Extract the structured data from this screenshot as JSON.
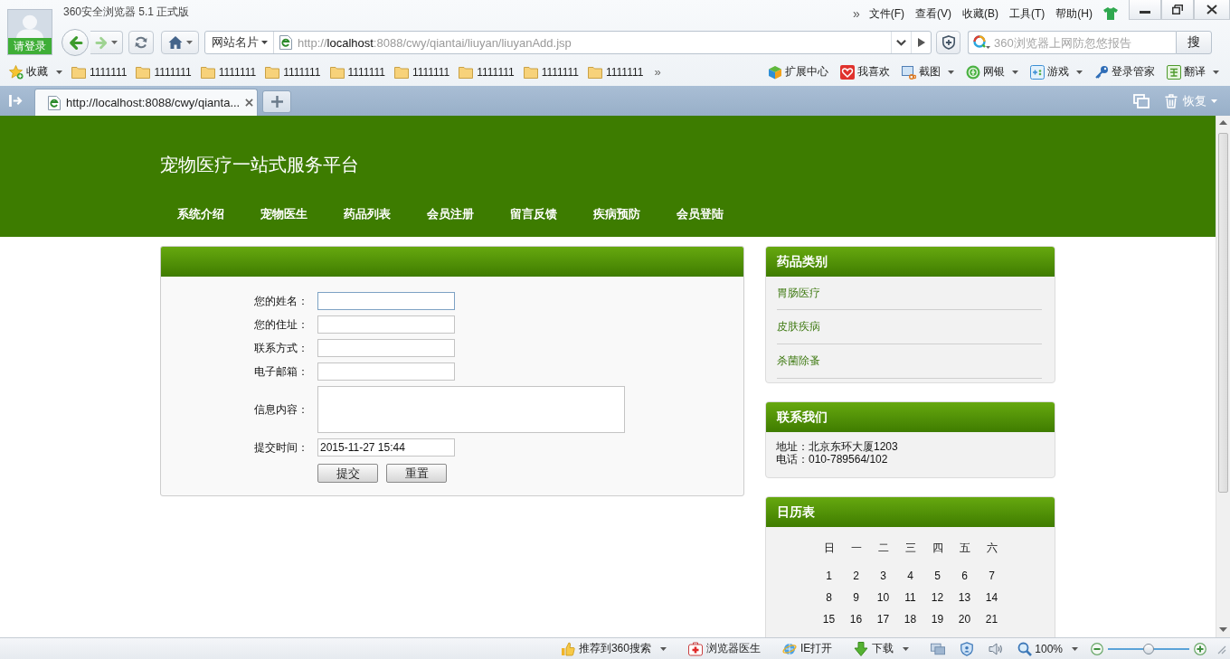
{
  "browser": {
    "title": "360安全浏览器 5.1 正式版",
    "login_label": "请登录",
    "menu_overflow": "»",
    "menu": [
      "文件(F)",
      "查看(V)",
      "收藏(B)",
      "工具(T)",
      "帮助(H)"
    ],
    "site_card": "网站名片",
    "address": "http://**localhost**:8088/cwy/qiantai/liuyan/liuyanAdd.jsp",
    "search": {
      "placeholder": "360浏览器上网防忽悠报告",
      "button": "搜"
    }
  },
  "bookmarks": {
    "favorites": "收藏",
    "folders": [
      "1111111",
      "1111111",
      "1111111",
      "1111111",
      "1111111",
      "1111111",
      "1111111",
      "1111111",
      "1111111"
    ],
    "overflow": "»",
    "tools": [
      {
        "label": "扩展中心",
        "dropdown": false
      },
      {
        "label": "我喜欢",
        "dropdown": false
      },
      {
        "label": "截图",
        "dropdown": true
      },
      {
        "label": "网银",
        "dropdown": true
      },
      {
        "label": "游戏",
        "dropdown": true
      },
      {
        "label": "登录管家",
        "dropdown": false
      },
      {
        "label": "翻译",
        "dropdown": true
      }
    ]
  },
  "tabs": {
    "items": [
      {
        "title": "http://localhost:8088/cwy/qianta...",
        "selected": true
      }
    ],
    "restore": "恢复"
  },
  "site": {
    "title": "宠物医疗一站式服务平台",
    "nav": [
      "系统介绍",
      "宠物医生",
      "药品列表",
      "会员注册",
      "留言反馈",
      "疾病预防",
      "会员登陆"
    ]
  },
  "form": {
    "fields": [
      {
        "label": "您的姓名：",
        "kind": "input",
        "focused": true
      },
      {
        "label": "您的住址：",
        "kind": "input",
        "focused": false
      },
      {
        "label": "联系方式：",
        "kind": "input",
        "focused": false
      },
      {
        "label": "电子邮箱：",
        "kind": "input",
        "focused": false
      },
      {
        "label": "信息内容：",
        "kind": "textarea",
        "focused": false
      },
      {
        "label": "提交时间：",
        "kind": "input",
        "focused": false,
        "value": "2015-11-27 15:44"
      }
    ],
    "buttons": [
      "提交",
      "重置"
    ]
  },
  "sidebar": {
    "categories": {
      "title": "药品类别",
      "items": [
        "胃肠医疗",
        "皮肤疾病",
        "杀菌除蚤"
      ]
    },
    "contact": {
      "title": "联系我们",
      "lines": [
        "地址：北京东环大厦1203",
        "电话：010-789564/102"
      ]
    },
    "calendar": {
      "title": "日历表",
      "weekdays": [
        "日",
        "一",
        "二",
        "三",
        "四",
        "五",
        "六"
      ],
      "weeks": [
        [
          "1",
          "2",
          "3",
          "4",
          "5",
          "6",
          "7"
        ],
        [
          "8",
          "9",
          "10",
          "11",
          "12",
          "13",
          "14"
        ],
        [
          "15",
          "16",
          "17",
          "18",
          "19",
          "20",
          "21"
        ]
      ]
    }
  },
  "status_bar": {
    "items": [
      {
        "label": "推荐到360搜索",
        "dropdown": true
      },
      {
        "label": "浏览器医生",
        "dropdown": false
      },
      {
        "label": "IE打开",
        "dropdown": false
      },
      {
        "label": "下载",
        "dropdown": true
      }
    ],
    "zoom": {
      "label": "100%",
      "level": 0.5
    }
  }
}
